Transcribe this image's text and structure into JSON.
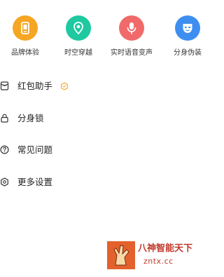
{
  "features": [
    {
      "label": "品牌体验",
      "icon": "phone-icon",
      "color": "#f5a623"
    },
    {
      "label": "时空穿越",
      "icon": "location-pin-icon",
      "color": "#1fc9a0"
    },
    {
      "label": "实时语音变声",
      "icon": "microphone-icon",
      "color": "#f06a6a"
    },
    {
      "label": "分身伪装",
      "icon": "mask-icon",
      "color": "#3d8ef0"
    }
  ],
  "menu": [
    {
      "label": "红包助手",
      "icon": "red-envelope-icon",
      "badge": "hexagon-badge-icon",
      "badge_color": "#f5a623"
    },
    {
      "label": "分身锁",
      "icon": "lock-icon"
    },
    {
      "label": "常见问题",
      "icon": "question-icon"
    },
    {
      "label": "更多设置",
      "icon": "settings-icon"
    }
  ],
  "watermark": {
    "title": "八神智能天下",
    "site": "zntx.cc"
  }
}
